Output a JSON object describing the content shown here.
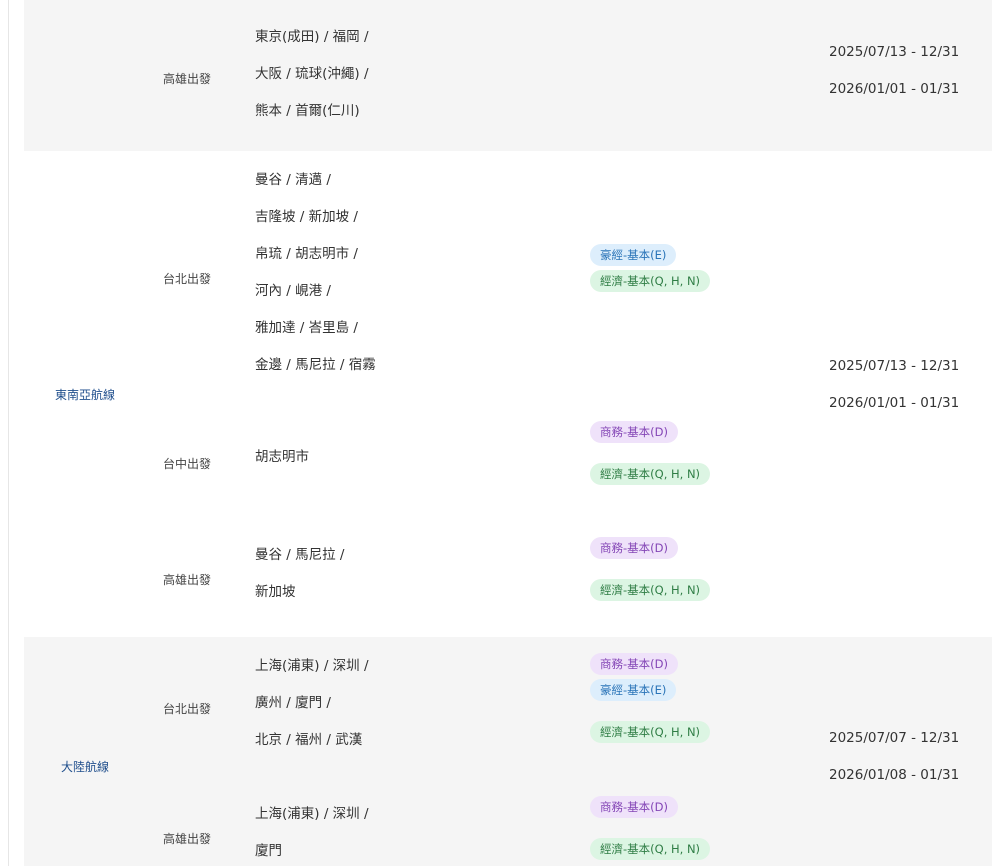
{
  "groups": [
    {
      "region": "",
      "subgroups": [
        {
          "depart": "高雄出發",
          "destinations": [
            "東京(成田) / 福岡 /",
            "大阪 / 琉球(沖繩) /",
            "熊本 / 首爾(仁川)"
          ],
          "badges": []
        }
      ],
      "dates": [
        "2025/07/13 - 12/31",
        "2026/01/01 - 01/31"
      ]
    },
    {
      "region": "東南亞航線",
      "subgroups": [
        {
          "depart": "台北出發",
          "destinations": [
            "曼谷 / 清邁 /",
            "吉隆坡 / 新加坡 /",
            "帛琉 / 胡志明市 /",
            "河內 / 峴港 /",
            "雅加達 / 峇里島 /",
            "金邊 / 馬尼拉 / 宿霧"
          ],
          "badges": [
            {
              "label": "豪經-基本(E)",
              "tone": "lux"
            },
            {
              "label": "經濟-基本(Q, H, N)",
              "tone": "eco"
            }
          ]
        },
        {
          "depart": "台中出發",
          "destinations": [
            "胡志明市"
          ],
          "badges": [
            {
              "label": "商務-基本(D)",
              "tone": "biz"
            },
            {
              "label": "經濟-基本(Q, H, N)",
              "tone": "eco"
            }
          ]
        },
        {
          "depart": "高雄出發",
          "destinations": [
            "曼谷 / 馬尼拉 /",
            "新加坡"
          ],
          "badges": [
            {
              "label": "商務-基本(D)",
              "tone": "biz"
            },
            {
              "label": "經濟-基本(Q, H, N)",
              "tone": "eco"
            }
          ]
        }
      ],
      "dates": [
        "2025/07/13 - 12/31",
        "2026/01/01 - 01/31"
      ]
    },
    {
      "region": "大陸航線",
      "subgroups": [
        {
          "depart": "台北出發",
          "destinations": [
            "上海(浦東) / 深圳 /",
            "廣州 / 廈門 /",
            "北京 / 福州 / 武漢"
          ],
          "badges": [
            {
              "label": "商務-基本(D)",
              "tone": "biz"
            },
            {
              "label": "豪經-基本(E)",
              "tone": "lux"
            },
            {
              "label": "經濟-基本(Q, H, N)",
              "tone": "eco"
            }
          ]
        },
        {
          "depart": "高雄出發",
          "destinations": [
            "上海(浦東) / 深圳 /",
            "廈門"
          ],
          "badges": [
            {
              "label": "商務-基本(D)",
              "tone": "biz"
            },
            {
              "label": "經濟-基本(Q, H, N)",
              "tone": "eco"
            }
          ]
        }
      ],
      "dates": [
        "2025/07/07 - 12/31",
        "2026/01/08 - 01/31"
      ]
    }
  ]
}
